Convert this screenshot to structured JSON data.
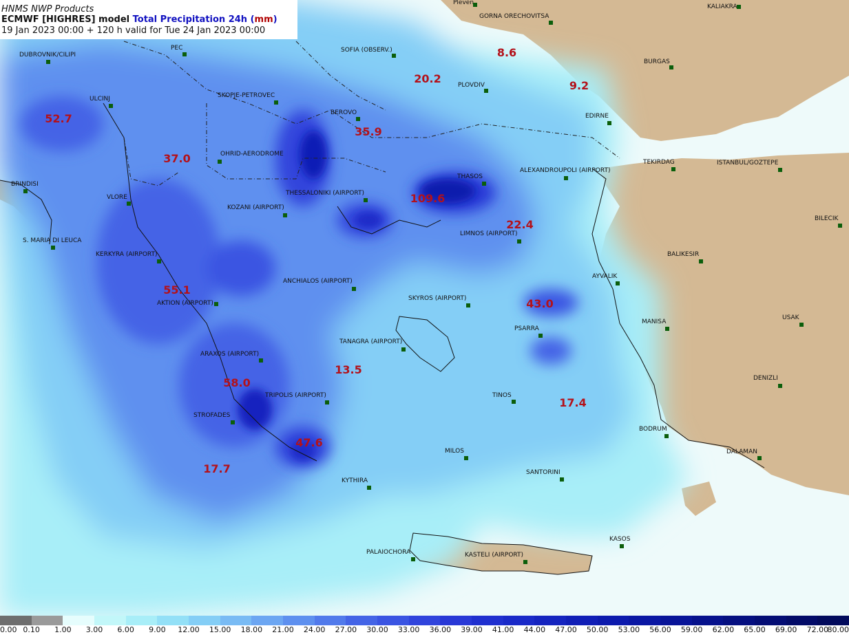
{
  "header": {
    "line1": "HNMS NWP Products",
    "line2_model": "ECMWF [HIGHRES] model ",
    "line2_field": "Total Precipitation 24h (",
    "line2_unit": "mm",
    "line2_close": ")",
    "line3": "19 Jan 2023 00:00 + 120 h valid for Tue 24 Jan 2023 00:00"
  },
  "stations": [
    {
      "name": "Pleven"
    },
    {
      "name": "GORNA ORECHOVITSA"
    },
    {
      "name": "KALIAKRA"
    },
    {
      "name": "DUBROVNIK/CILIPI"
    },
    {
      "name": "PEC"
    },
    {
      "name": "SOFIA (OBSERV.)"
    },
    {
      "name": "BURGAS"
    },
    {
      "name": "ULCINJ"
    },
    {
      "name": "SKOPJE-PETROVEC"
    },
    {
      "name": "PLOVDIV"
    },
    {
      "name": "BEROVO"
    },
    {
      "name": "EDIRNE"
    },
    {
      "name": "OHRID-AERODROME"
    },
    {
      "name": "TEKIRDAG"
    },
    {
      "name": "ISTANBUL/GOZTEPE"
    },
    {
      "name": "ALEXANDROUPOLI (AIRPORT)"
    },
    {
      "name": "THASOS"
    },
    {
      "name": "BRINDISI"
    },
    {
      "name": "VLORE"
    },
    {
      "name": "THESSALONIKI (AIRPORT)"
    },
    {
      "name": "KOZANI (AIRPORT)"
    },
    {
      "name": "BILECIK"
    },
    {
      "name": "S. MARIA DI LEUCA"
    },
    {
      "name": "LIMNOS (AIRPORT)"
    },
    {
      "name": "KERKYRA (AIRPORT)"
    },
    {
      "name": "BALIKESIR"
    },
    {
      "name": "ANCHIALOS (AIRPORT)"
    },
    {
      "name": "AYVALIK"
    },
    {
      "name": "SKYROS (AIRPORT)"
    },
    {
      "name": "AKTION (AIRPORT)"
    },
    {
      "name": "MANISA"
    },
    {
      "name": "USAK"
    },
    {
      "name": "PSARRA"
    },
    {
      "name": "TANAGRA (AIRPORT)"
    },
    {
      "name": "ARAXOS (AIRPORT)"
    },
    {
      "name": "DENIZLI"
    },
    {
      "name": "TRIPOLIS (AIRPORT)"
    },
    {
      "name": "TINOS"
    },
    {
      "name": "STROFADES"
    },
    {
      "name": "BODRUM"
    },
    {
      "name": "MILOS"
    },
    {
      "name": "DALAMAN"
    },
    {
      "name": "SANTORINI"
    },
    {
      "name": "KYTHIRA"
    },
    {
      "name": "KASOS"
    },
    {
      "name": "PALAIOCHORA"
    },
    {
      "name": "KASTELI (AIRPORT)"
    }
  ],
  "maxima": [
    {
      "value": "8.6"
    },
    {
      "value": "20.2"
    },
    {
      "value": "9.2"
    },
    {
      "value": "52.7"
    },
    {
      "value": "35.9"
    },
    {
      "value": "37.0"
    },
    {
      "value": "109.6"
    },
    {
      "value": "22.4"
    },
    {
      "value": "55.1"
    },
    {
      "value": "43.0"
    },
    {
      "value": "13.5"
    },
    {
      "value": "58.0"
    },
    {
      "value": "17.4"
    },
    {
      "value": "47.6"
    },
    {
      "value": "17.7"
    }
  ],
  "colorbar": {
    "ticks": [
      "0.00",
      "0.10",
      "1.00",
      "3.00",
      "6.00",
      "9.00",
      "12.00",
      "15.00",
      "18.00",
      "21.00",
      "24.00",
      "27.00",
      "30.00",
      "33.00",
      "36.00",
      "39.00",
      "41.00",
      "44.00",
      "47.00",
      "50.00",
      "53.00",
      "56.00",
      "59.00",
      "62.00",
      "65.00",
      "69.00",
      "72.00",
      "80.00"
    ],
    "colors": [
      "#6e6e6e",
      "#9a9a9a",
      "#e6fdfd",
      "#c2f7f9",
      "#a8eef8",
      "#93e0f7",
      "#84cef6",
      "#79bbf4",
      "#6ca6f2",
      "#5e90ef",
      "#517aeb",
      "#4464e6",
      "#3a54e2",
      "#3044dc",
      "#2838d6",
      "#2030cf",
      "#1a2ac8",
      "#1524bf",
      "#101eb6",
      "#0c1aad",
      "#0a17a3",
      "#081498",
      "#06118c",
      "#050f80",
      "#040d74",
      "#030b68",
      "#020a5c"
    ]
  },
  "colors": {
    "land": "#d4b994",
    "sea": "#eefafa",
    "station": "#0b5e0b",
    "maxima": "#b3111a"
  }
}
